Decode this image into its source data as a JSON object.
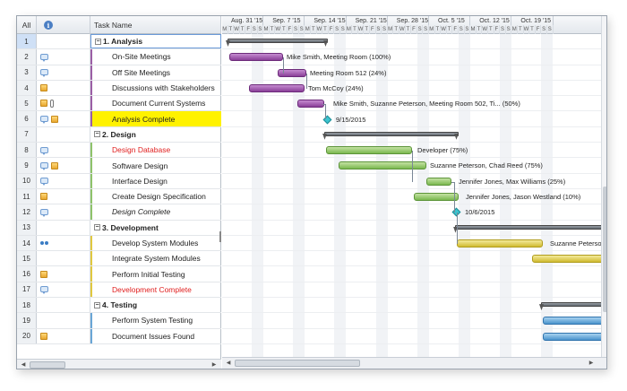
{
  "grid": {
    "col_all": "All",
    "col_task": "Task Name",
    "rows": [
      {
        "num": "1",
        "name": "1. Analysis",
        "summary": true,
        "icons": []
      },
      {
        "num": "2",
        "name": "On-Site Meetings",
        "icons": [
          "note"
        ]
      },
      {
        "num": "3",
        "name": "Off Site Meetings",
        "icons": [
          "note"
        ]
      },
      {
        "num": "4",
        "name": "Discussions with Stakeholders",
        "icons": [
          "res"
        ]
      },
      {
        "num": "5",
        "name": "Document Current Systems",
        "icons": [
          "res",
          "clip"
        ]
      },
      {
        "num": "6",
        "name": "Analysis Complete",
        "icons": [
          "note",
          "res"
        ]
      },
      {
        "num": "7",
        "name": "2. Design",
        "summary": true,
        "icons": []
      },
      {
        "num": "8",
        "name": "Design Database",
        "icons": [
          "note"
        ]
      },
      {
        "num": "9",
        "name": "Software Design",
        "icons": [
          "note",
          "res"
        ]
      },
      {
        "num": "10",
        "name": "Interface Design",
        "icons": [
          "note"
        ]
      },
      {
        "num": "11",
        "name": "Create Design Specification",
        "icons": [
          "res"
        ]
      },
      {
        "num": "12",
        "name": "Design Complete",
        "icons": [
          "note"
        ]
      },
      {
        "num": "13",
        "name": "3. Development",
        "summary": true,
        "icons": []
      },
      {
        "num": "14",
        "name": "Develop System Modules",
        "icons": [
          "link"
        ]
      },
      {
        "num": "15",
        "name": "Integrate System Modules",
        "icons": []
      },
      {
        "num": "16",
        "name": "Perform Initial Testing",
        "icons": [
          "res"
        ]
      },
      {
        "num": "17",
        "name": "Development Complete",
        "icons": [
          "note"
        ]
      },
      {
        "num": "18",
        "name": "4. Testing",
        "summary": true,
        "icons": []
      },
      {
        "num": "19",
        "name": "Perform System Testing",
        "icons": []
      },
      {
        "num": "20",
        "name": "Document Issues Found",
        "icons": [
          "res"
        ]
      }
    ]
  },
  "timeline": {
    "weeks": [
      "Aug. 31 '15",
      "Sep. 7 '15",
      "Sep. 14 '15",
      "Sep. 21 '15",
      "Sep. 28 '15",
      "Oct. 5 '15",
      "Oct. 12 '15",
      "Oct. 19 '15"
    ],
    "days": [
      "M",
      "T",
      "W",
      "T",
      "F",
      "S",
      "S"
    ]
  },
  "labels": {
    "r2": "Mike Smith, Meeting Room (100%)",
    "r3": "Meeting Room 512 (24%)",
    "r4": "Tom McCoy (24%)",
    "r5": "Mike Smith, Suzanne Peterson, Meeting Room 502, Ti... (50%)",
    "r6": "9/15/2015",
    "r8": "Developer (75%)",
    "r9": "Suzanne Peterson, Chad Reed (75%)",
    "r10": "Jennifer Jones, Max Williams (25%)",
    "r11": "Jennifer Jones, Jason Westland (10%)",
    "r12": "10/6/2015",
    "r14": "Suzanne Peterson, Doug C"
  }
}
